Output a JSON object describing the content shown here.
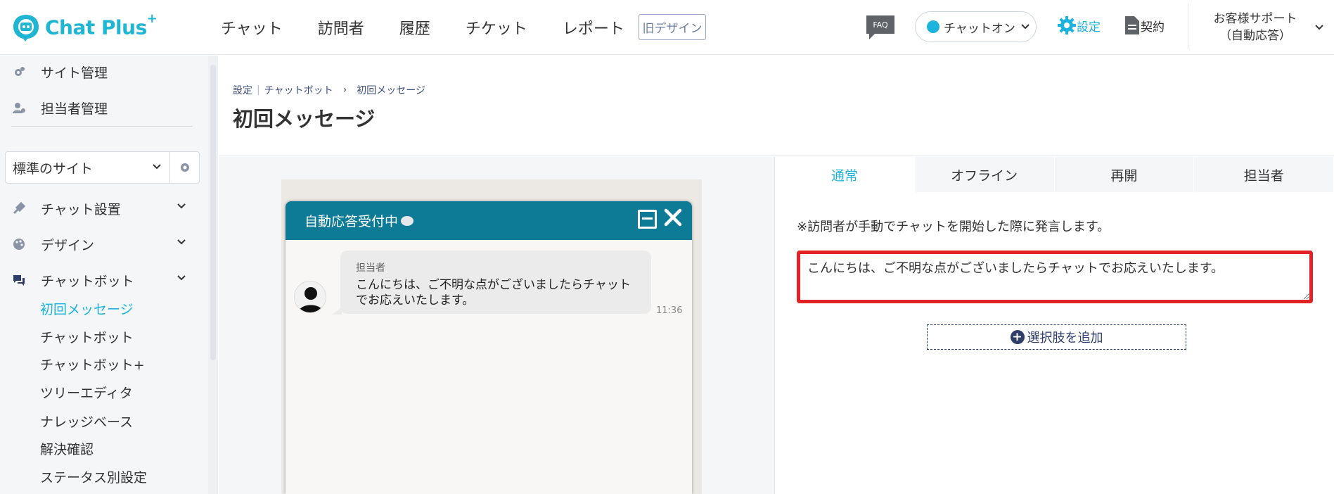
{
  "header": {
    "logo_text": "Chat Plus",
    "logo_sup": "+",
    "nav": [
      "チャット",
      "訪問者",
      "履歴",
      "チケット",
      "レポート"
    ],
    "old_design": "旧デザイン",
    "faq": "FAQ",
    "chat_status": "チャットオン",
    "settings": "設定",
    "contract": "契約",
    "support_line1": "お客様サポート",
    "support_line2": "（自動応答）"
  },
  "sidebar": {
    "site_management": "サイト管理",
    "staff_management": "担当者管理",
    "site_select": "標準のサイト",
    "chat_setup": "チャット設置",
    "design": "デザイン",
    "chatbot": "チャットボット",
    "sub_items": [
      "初回メッセージ",
      "チャットボット",
      "チャットボット+",
      "ツリーエディタ",
      "ナレッジベース",
      "解決確認",
      "ステータス別設定"
    ],
    "active_sub": "初回メッセージ"
  },
  "breadcrumb": {
    "root": "設定",
    "section": "チャットボット",
    "current": "初回メッセージ"
  },
  "page_title": "初回メッセージ",
  "preview": {
    "header_title": "自動応答受付中",
    "sender": "担当者",
    "message": "こんにちは、ご不明な点がございましたらチャットでお応えいたします。",
    "time": "11:36"
  },
  "tabs": [
    "通常",
    "オフライン",
    "再開",
    "担当者"
  ],
  "active_tab": "通常",
  "note": "※訪問者が手動でチャットを開始した際に発言します。",
  "message_input_value": "こんにちは、ご不明な点がございましたらチャットでお応えいたします。",
  "add_choice": "選択肢を追加",
  "colors": {
    "accent": "#1cb3dd",
    "chat_header": "#0d7b96",
    "highlight": "#e32225",
    "navy": "#2f3d6b"
  }
}
